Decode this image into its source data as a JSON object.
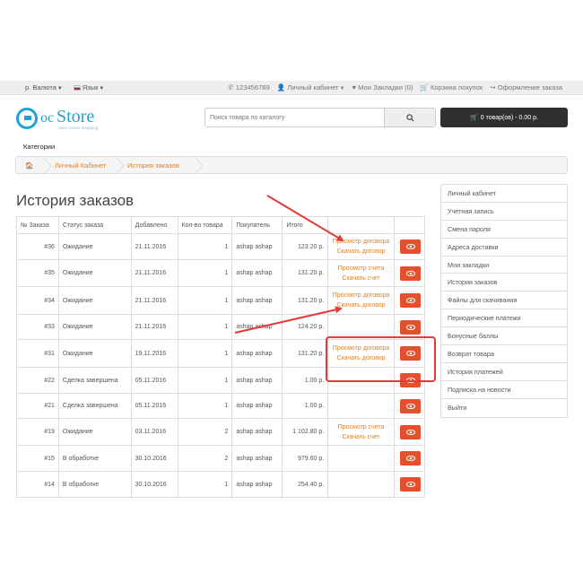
{
  "topbar": {
    "currency": "р. Валюта",
    "language": "Язык",
    "phone": "123456789",
    "account": "Личный кабинет",
    "wishlist": "Мои Закладки (0)",
    "cart": "Корзина покупок",
    "checkout": "Оформление заказа"
  },
  "logo": {
    "oc": "oc",
    "store": "Store",
    "tagline": "open source shopping"
  },
  "search": {
    "placeholder": "Поиск товара по каталогу"
  },
  "cart_button": {
    "label": "0 товар(ов) - 0.00 р."
  },
  "categories": "Категории",
  "breadcrumb": {
    "personal": "Личный Кабинет",
    "history": "История заказов"
  },
  "page_title": "История заказов",
  "table": {
    "headers": [
      "№ Заказа",
      "Статус заказа",
      "Добавлено",
      "Кол-во товара",
      "Покупатель",
      "Итого"
    ],
    "rows": [
      {
        "id": "#36",
        "status": "Ожидание",
        "date": "21.11.2016",
        "qty": "1",
        "customer": "ashap ashap",
        "total": "123.20 р.",
        "link1": "Просмотр договора",
        "link2": "Скачать договор"
      },
      {
        "id": "#35",
        "status": "Ожидание",
        "date": "21.11.2016",
        "qty": "1",
        "customer": "ashap ashap",
        "total": "131.20 р.",
        "link1": "Просмотр счета",
        "link2": "Скачать счет"
      },
      {
        "id": "#34",
        "status": "Ожидание",
        "date": "21.11.2016",
        "qty": "1",
        "customer": "ashap ashap",
        "total": "131.20 р.",
        "link1": "Просмотр договора",
        "link2": "Скачать договор"
      },
      {
        "id": "#33",
        "status": "Ожидание",
        "date": "21.11.2016",
        "qty": "1",
        "customer": "ashap ashap",
        "total": "124.20 р.",
        "link1": "",
        "link2": ""
      },
      {
        "id": "#31",
        "status": "Ожидание",
        "date": "19.11.2016",
        "qty": "1",
        "customer": "ashap ashap",
        "total": "131.20 р.",
        "link1": "Просмотр договора",
        "link2": "Скачать договор"
      },
      {
        "id": "#22",
        "status": "Сделка завершена",
        "date": "05.11.2016",
        "qty": "1",
        "customer": "ashap ashap",
        "total": "1.00 р.",
        "link1": "",
        "link2": ""
      },
      {
        "id": "#21",
        "status": "Сделка завершена",
        "date": "05.11.2016",
        "qty": "1",
        "customer": "ashap ashap",
        "total": "1.00 р.",
        "link1": "",
        "link2": ""
      },
      {
        "id": "#19",
        "status": "Ожидание",
        "date": "03.11.2016",
        "qty": "2",
        "customer": "ashap ashap",
        "total": "1 102.80 р.",
        "link1": "Просмотр счета",
        "link2": "Скачать счет"
      },
      {
        "id": "#15",
        "status": "В обработке",
        "date": "30.10.2016",
        "qty": "2",
        "customer": "ashap ashap",
        "total": "979.60 р.",
        "link1": "",
        "link2": ""
      },
      {
        "id": "#14",
        "status": "В обработке",
        "date": "30.10.2016",
        "qty": "1",
        "customer": "ashap ashap",
        "total": "254.40 р.",
        "link1": "",
        "link2": ""
      }
    ]
  },
  "sidemenu": [
    "Личный кабинет",
    "Учетная запись",
    "Смена пароля",
    "Адреса доставки",
    "Мои закладки",
    "История заказов",
    "Файлы для скачивания",
    "Периодические платежи",
    "Бонусные баллы",
    "Возврат товара",
    "История платежей",
    "Подписка на новости",
    "Выйти"
  ],
  "colors": {
    "accent": "#e08020",
    "button": "#e5502c",
    "annotation": "#e03a3a",
    "logo": "#23a1d1"
  }
}
